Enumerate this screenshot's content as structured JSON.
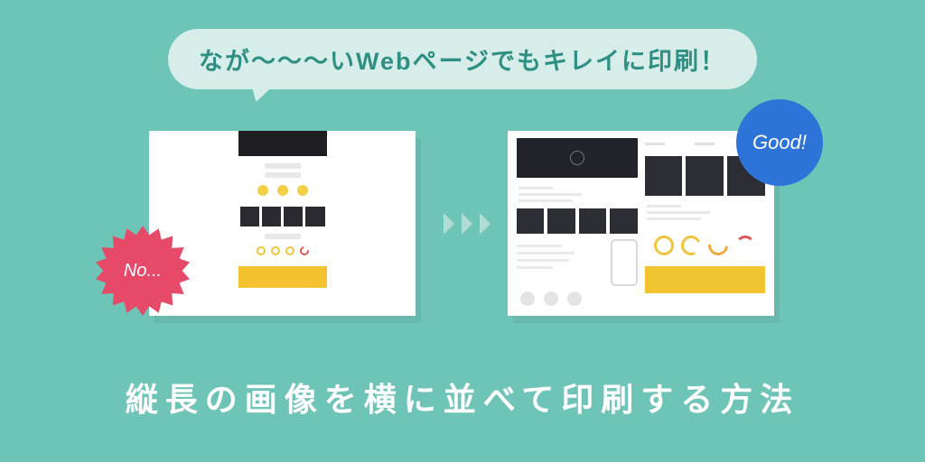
{
  "bubble": {
    "text": "なが〜〜〜いWebページでもキレイに印刷！"
  },
  "badges": {
    "no": {
      "label": "No..."
    },
    "good": {
      "label": "Good!"
    }
  },
  "title": "縦長の画像を横に並べて印刷する方法",
  "colors": {
    "bg": "#6fc4b8",
    "bubble_bg": "#d6ede9",
    "bubble_text": "#2e8f83",
    "good_badge": "#2e74d8",
    "no_badge": "#e74a69",
    "accent_yellow": "#f3c22e"
  }
}
